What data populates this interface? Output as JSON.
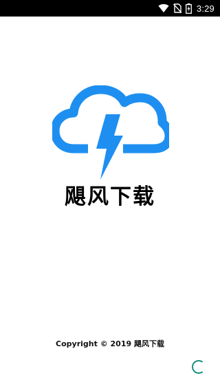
{
  "status_bar": {
    "time": "3:29",
    "icons": [
      "wifi-icon",
      "no-sim-icon",
      "battery-charging-icon"
    ]
  },
  "splash": {
    "logo_icon": "cloud-lightning-icon",
    "app_name": "飓风下载",
    "copyright": "Copyright © 2019 飓风下载",
    "loading_icon": "loading-spinner-icon"
  },
  "colors": {
    "status_bar_bg": "#000000",
    "background": "#ffffff",
    "logo_blue": "#1e8ff0",
    "spinner_teal": "#17917f",
    "text": "#000000"
  }
}
